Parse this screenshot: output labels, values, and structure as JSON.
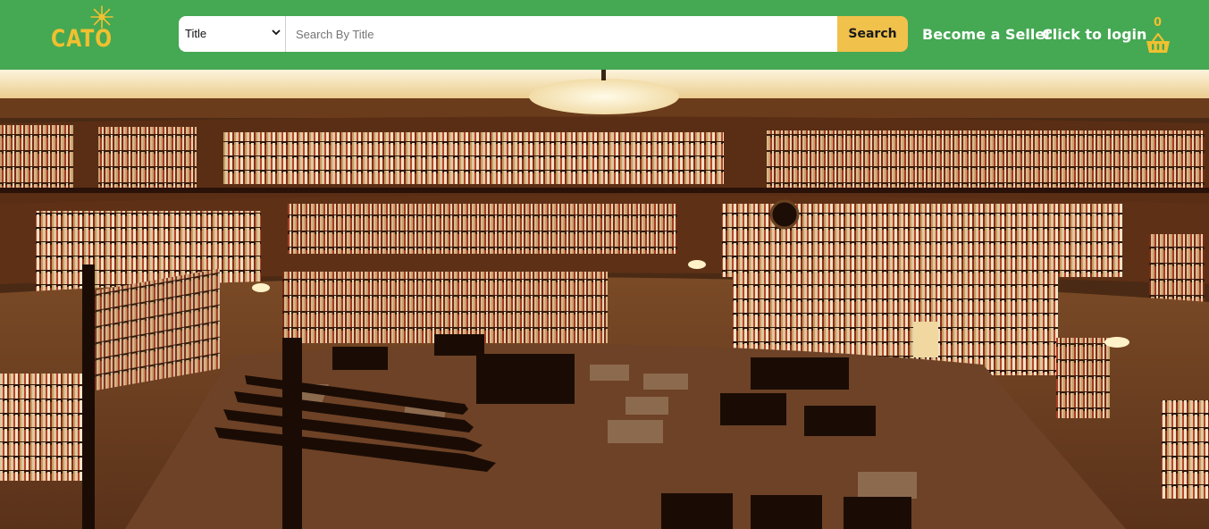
{
  "brand": {
    "name": "CATO"
  },
  "search": {
    "category_options": [
      "Title"
    ],
    "category_selected": "Title",
    "placeholder": "Search By Title",
    "value": "",
    "button_label": "Search"
  },
  "nav": {
    "seller_label": "Become a Seller",
    "login_label": "Click to login",
    "cart_count": "0"
  },
  "hero": {
    "image_subject": "library-interior-photo"
  },
  "colors": {
    "header_bg": "#45a853",
    "accent_yellow": "#f0c14b",
    "logo_yellow": "#f0c030",
    "nav_text": "#ffffff"
  },
  "icons": {
    "logo_spark": "sparkle-icon",
    "select_caret": "chevron-down-icon",
    "cart": "basket-icon"
  }
}
